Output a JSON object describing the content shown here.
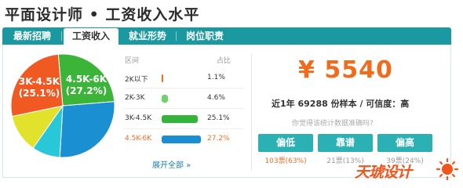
{
  "page": {
    "title": "平面设计师 • 工资收入水平"
  },
  "tabs": [
    {
      "label": "最新招聘"
    },
    {
      "label": "工资收入"
    },
    {
      "label": "就业形势"
    },
    {
      "label": "岗位职责"
    }
  ],
  "pie": {
    "labels": [
      {
        "range": "3K-4.5K",
        "pct": "(25.1%)"
      },
      {
        "range": "4.5K-6K",
        "pct": "(27.2%)"
      }
    ]
  },
  "table": {
    "headers": {
      "range": "区间",
      "share": "占比"
    },
    "rows": [
      {
        "label": "2K以下",
        "pct": "1.1%",
        "value": 1.1,
        "color": "#f26a1b"
      },
      {
        "label": "2K-3K",
        "pct": "4.6%",
        "value": 4.6,
        "color": "#6fd36a"
      },
      {
        "label": "3K-4.5K",
        "pct": "25.1%",
        "value": 25.1,
        "color": "#35b43a"
      },
      {
        "label": "4.5K-6K",
        "pct": "27.2%",
        "value": 27.2,
        "color": "#1a8ed0"
      }
    ],
    "more": "展开全部 »"
  },
  "chart_data": {
    "type": "pie",
    "slices": [
      {
        "label": "3K-4.5K",
        "value": 25.1,
        "color": "#3cb43a"
      },
      {
        "label": "4.5K-6K",
        "value": 27.2,
        "color": "#1a8fd2"
      },
      {
        "value": 8.8,
        "color": "#29c8d8"
      },
      {
        "value": 12.0,
        "color": "#e2e12b"
      },
      {
        "value": 26.9,
        "color": "#f05a22"
      }
    ]
  },
  "summary": {
    "salary": "¥ 5540",
    "sample_prefix": "近1年",
    "sample_count": "69288",
    "sample_suffix": "份样本 / 可信度：高",
    "question": "你觉得该统计数据准确吗?"
  },
  "votes": [
    {
      "label": "偏低",
      "count": "103票",
      "pct": "(63%)",
      "highlight": true
    },
    {
      "label": "靠谱",
      "count": "21票",
      "pct": "(13%)",
      "highlight": false
    },
    {
      "label": "偏高",
      "count": "39票",
      "pct": "(24%)",
      "highlight": false
    }
  ],
  "brand": {
    "logo_text": "天琥设计"
  },
  "colors": {
    "accent": "#1a9aa0",
    "salary": "#f26a1b",
    "button": "#2bb0b4"
  }
}
